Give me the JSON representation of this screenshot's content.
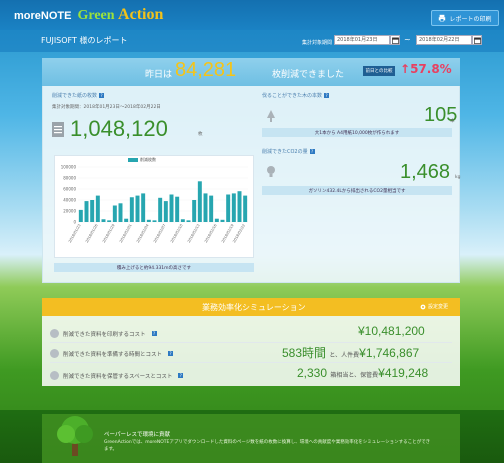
{
  "header": {
    "logo_more": "moreNOTE",
    "logo_green": "Green",
    "logo_action": "Action",
    "print_button": "レポートの印刷"
  },
  "subheader": {
    "report_title": "FUJISOFT 様のレポート",
    "period_label": "集計対象期間",
    "date_from": "2018年01月23日",
    "date_to": "2018年02月22日",
    "tilde": "~"
  },
  "headline": {
    "prefix": "昨日は",
    "number": "84,281",
    "suffix": "枚削減できました",
    "compare_badge": "前日との比較",
    "arrow": "↑",
    "percent": "57.8%"
  },
  "paper": {
    "label": "削減できた紙の枚数",
    "period_text": "集計対象期間：2018年01月23日～2018年02月22日",
    "value": "1,048,120",
    "unit": "枚",
    "note": "積み上げると約94.331mの高さです"
  },
  "trees": {
    "label": "伐ることができた木の本数",
    "value": "105",
    "unit": "本",
    "note": "大1本から A4用紙10,000枚が作られます"
  },
  "co2": {
    "label": "削減できたCO2の量",
    "value": "1,468",
    "unit": "kg",
    "note": "ガソリン432.4Lから排出されるCO2量相当です"
  },
  "chart_data": {
    "type": "bar",
    "legend": "削減枚数",
    "ylim": [
      0,
      100000
    ],
    "yticks": [
      "100000",
      "80000",
      "60000",
      "40000",
      "20000",
      "0"
    ],
    "categories": [
      "2018/01/23",
      "",
      "",
      "2018/01/26",
      "",
      "",
      "2018/01/29",
      "",
      "",
      "2018/02/01",
      "",
      "",
      "2018/02/04",
      "",
      "",
      "2018/02/07",
      "",
      "",
      "2018/02/10",
      "",
      "",
      "2018/02/13",
      "",
      "",
      "2018/02/16",
      "",
      "",
      "2018/02/19",
      "",
      "2018/02/22"
    ],
    "values": [
      22000,
      38000,
      40000,
      48000,
      5000,
      3000,
      30000,
      34000,
      6000,
      45000,
      48000,
      52000,
      4000,
      3000,
      44000,
      38000,
      50000,
      46000,
      5000,
      3000,
      40000,
      74000,
      52000,
      48000,
      6000,
      4000,
      50000,
      52000,
      56000,
      48000
    ]
  },
  "simulation": {
    "title": "業務効率化シミュレーション",
    "settings": "設定変更",
    "rows": [
      {
        "label": "削減できた資料を印刷するコスト",
        "value": "¥10,481,200",
        "mid": "",
        "tail": ""
      },
      {
        "label": "削減できた資料を準備する時間とコスト",
        "value": "583時間",
        "mid": "と、人件費",
        "tail": "¥1,746,867"
      },
      {
        "label": "削減できた資料を保管するスペースとコスト",
        "value": "2,330",
        "mid": "箱相当と、保管費",
        "tail": "¥419,248"
      }
    ]
  },
  "footer": {
    "title": "ペーパーレスで環境に貢献",
    "text": "GreenActionでは、moreNOTEアプリでダウンロードした資料のページ数を紙の枚数に換算し、環境への貢献度や業務効率化をシミュレーションすることができます。"
  }
}
